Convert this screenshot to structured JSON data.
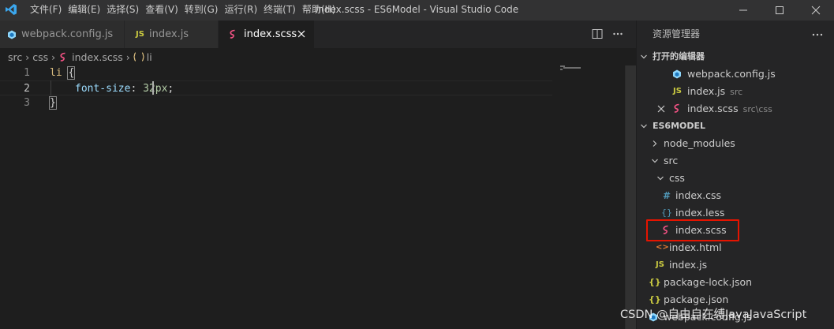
{
  "menu": [
    "文件(F)",
    "编辑(E)",
    "选择(S)",
    "查看(V)",
    "转到(G)",
    "运行(R)",
    "终端(T)",
    "帮助(H)"
  ],
  "window_title": "index.scss - ES6Model - Visual Studio Code",
  "tabs": [
    {
      "label": "webpack.config.js",
      "icon": "webpack-icon"
    },
    {
      "label": "index.js",
      "icon": "js-icon"
    },
    {
      "label": "index.scss",
      "icon": "sass-icon"
    }
  ],
  "breadcrumb": {
    "a": "src",
    "b": "css",
    "c": "index.scss",
    "d": "li"
  },
  "editor": {
    "lines": [
      "1",
      "2",
      "3"
    ],
    "l1": {
      "sel": "li",
      "brace": "{"
    },
    "l2": {
      "prop": "font-size",
      "colon": ":",
      "num_a": "32",
      "num_b": "px",
      "semi": ";"
    },
    "l3": {
      "brace": "}"
    }
  },
  "explorer": {
    "title": "资源管理器",
    "open_editors_title": "打开的编辑器",
    "open_editors": [
      {
        "label": "webpack.config.js",
        "desc": ""
      },
      {
        "label": "index.js",
        "desc": "src"
      },
      {
        "label": "index.scss",
        "desc": "src\\css"
      }
    ],
    "project_title": "ES6MODEL",
    "tree": {
      "node_modules": "node_modules",
      "src": "src",
      "css": "css",
      "index_css": "index.css",
      "index_less": "index.less",
      "index_scss": "index.scss",
      "index_html": "index.html",
      "index_js": "index.js",
      "package_lock": "package-lock.json",
      "package_json": "package.json",
      "webpack_config": "webpack.config.js"
    },
    "icons": {
      "css": "#",
      "less": "{}",
      "html": "<>",
      "js": "JS",
      "json": "{}"
    }
  },
  "watermark": "CSDN @自由自在缚JavaJavaScript",
  "colors": {
    "highlight": "#e51400",
    "accent_blue": "#0098ff",
    "js_yellow": "#cbcb41",
    "sass_pink": "#f55385"
  }
}
